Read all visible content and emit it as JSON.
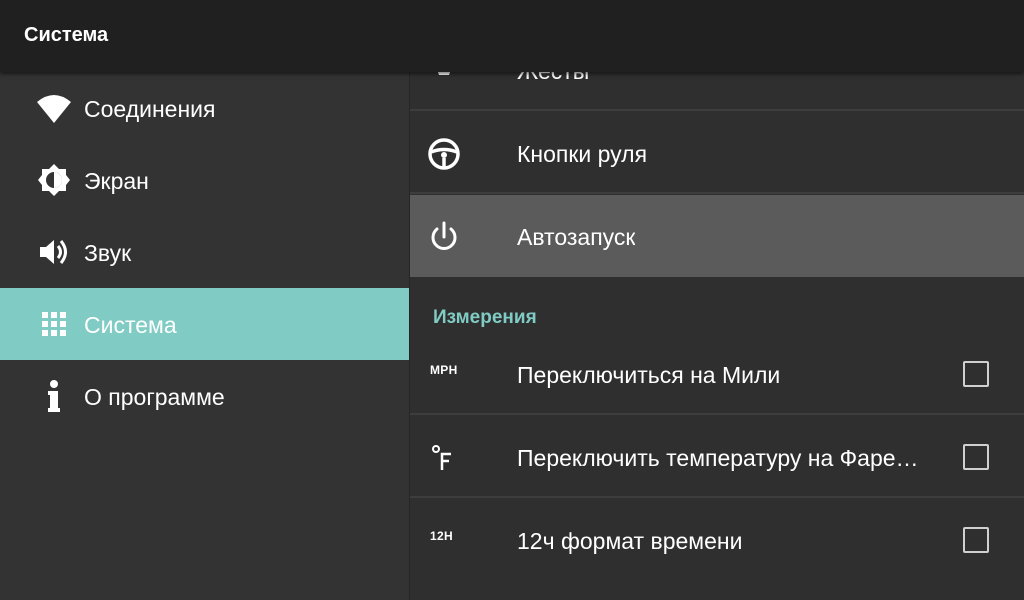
{
  "appbar": {
    "title": "Система"
  },
  "sidebar": {
    "items": [
      {
        "label": "Соединения",
        "icon": "wifi-icon"
      },
      {
        "label": "Экран",
        "icon": "brightness-icon"
      },
      {
        "label": "Звук",
        "icon": "volume-icon"
      },
      {
        "label": "Система",
        "icon": "apps-grid-icon",
        "active": true
      },
      {
        "label": "О программе",
        "icon": "info-icon"
      }
    ]
  },
  "content": {
    "rows": [
      {
        "label": "Жесты",
        "icon": "gesture-icon"
      },
      {
        "label": "Кнопки руля",
        "icon": "steering-wheel-icon"
      },
      {
        "label": "Автозапуск",
        "icon": "power-icon",
        "highlighted": true
      }
    ],
    "measurements": {
      "header": "Измерения",
      "items": [
        {
          "icon_text": "MPH",
          "label": "Переключиться на Мили",
          "checked": false
        },
        {
          "icon_text": "°F",
          "label": "Переключить температуру на Фаренгейт",
          "checked": false
        },
        {
          "icon_text": "12H",
          "label": "12ч формат времени",
          "checked": false
        }
      ]
    }
  },
  "colors": {
    "accent": "#80cbc4",
    "appbar": "#202020",
    "sidebar": "#333333",
    "content": "#2f2f2f",
    "highlight_row": "#5b5b5b"
  }
}
